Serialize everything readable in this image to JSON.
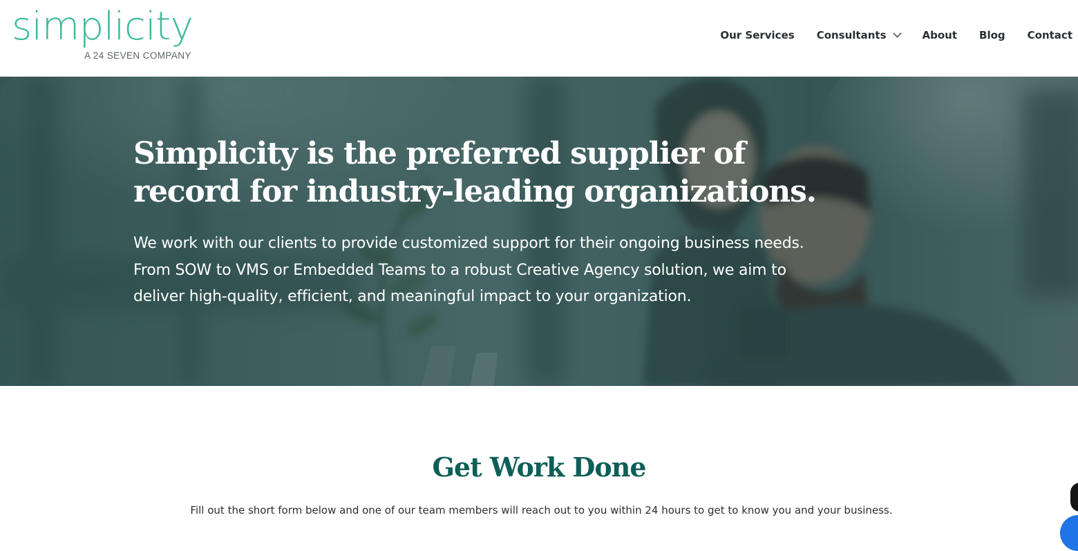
{
  "brand": {
    "logo_word": "simplicity",
    "logo_tagline": "A 24 SEVEN COMPANY",
    "accent_color": "#3dba9b",
    "heading_color": "#0e5e58"
  },
  "nav": {
    "items": [
      {
        "label": "Our Services"
      },
      {
        "label": "Consultants",
        "has_dropdown": true
      },
      {
        "label": "About"
      },
      {
        "label": "Blog"
      },
      {
        "label": "Contact"
      }
    ]
  },
  "hero": {
    "title": "Simplicity is the preferred supplier of record for industry-leading organizations.",
    "text": "We work with our clients to provide customized support for their ongoing business needs. From SOW to VMS or Embedded Teams to a robust Creative Agency solution, we aim to deliver high-quality, efficient, and meaningful impact to your organization."
  },
  "section": {
    "title": "Get Work Done",
    "subtitle": "Fill out the short form below and one of our team members will reach out to you within 24 hours to get to know you and your business."
  }
}
